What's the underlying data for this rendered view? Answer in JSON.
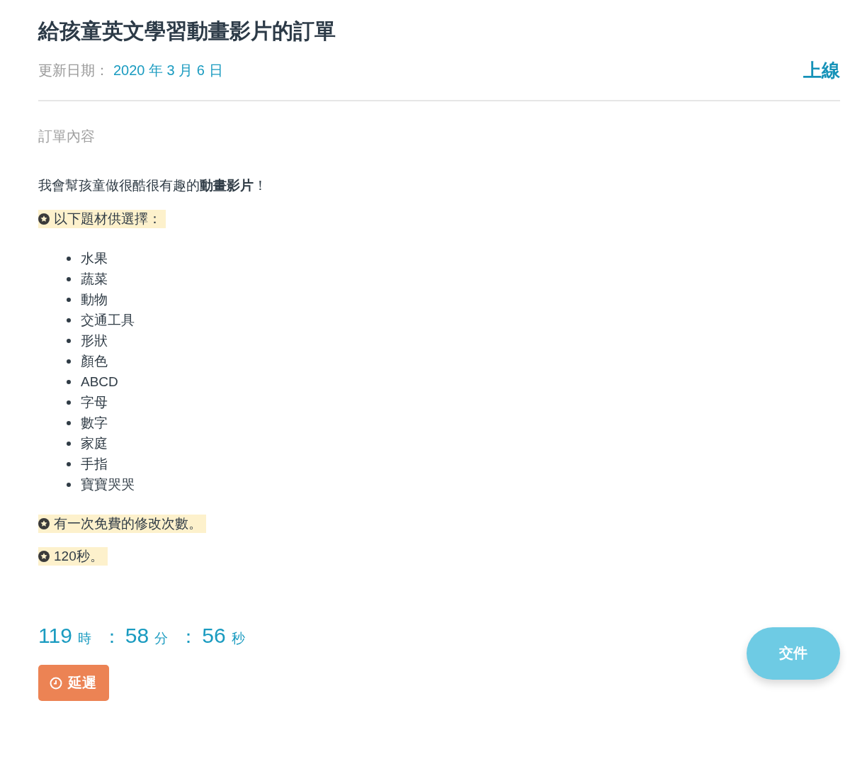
{
  "title": "給孩童英文學習動畫影片的訂單",
  "updated": {
    "label": "更新日期：",
    "date": "2020 年 3 月 6 日"
  },
  "status": "上線",
  "section_label": "訂單內容",
  "content": [
    {
      "kind": "paragraph",
      "text": "我會幫孩童做很酷很有趣的**動畫影片**！"
    },
    {
      "kind": "note",
      "text": "以下題材供選擇："
    },
    {
      "kind": "list",
      "items": [
        "水果",
        "蔬菜",
        "動物",
        "交通工具",
        "形狀",
        "顏色",
        "ABCD",
        "字母",
        "數字",
        "家庭",
        "手指",
        "寶寶哭哭"
      ]
    },
    {
      "kind": "note",
      "text": "有一次免費的修改次數。"
    },
    {
      "kind": "note",
      "text": "120秒。"
    }
  ],
  "countdown": {
    "separator": "：",
    "parts": [
      {
        "value": "119",
        "unit": "時"
      },
      {
        "value": "58",
        "unit": "分"
      },
      {
        "value": "56",
        "unit": "秒"
      }
    ]
  },
  "delay_button": "延遲",
  "submit_button": "交件"
}
